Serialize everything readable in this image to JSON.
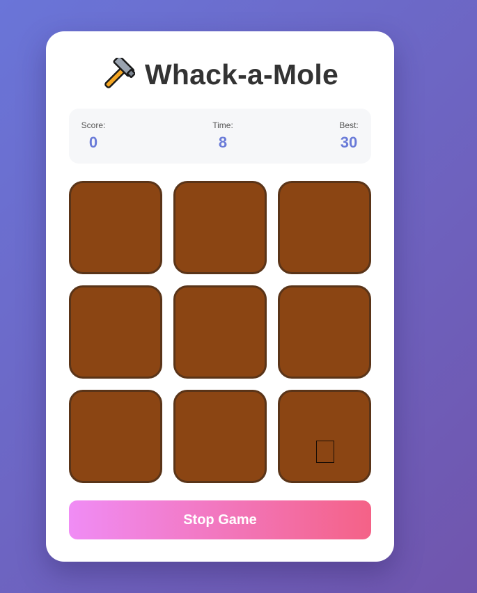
{
  "game": {
    "title": "Whack-a-Mole",
    "title_icon": "hammer-icon"
  },
  "stats": {
    "score_label": "Score:",
    "score_value": "0",
    "time_label": "Time:",
    "time_value": "8",
    "best_label": "Best:",
    "best_value": "30"
  },
  "board": {
    "rows": 3,
    "columns": 3,
    "active_hole": 9,
    "holes": [
      {
        "id": 1,
        "state": "empty"
      },
      {
        "id": 2,
        "state": "empty"
      },
      {
        "id": 3,
        "state": "empty"
      },
      {
        "id": 4,
        "state": "empty"
      },
      {
        "id": 5,
        "state": "empty"
      },
      {
        "id": 6,
        "state": "empty"
      },
      {
        "id": 7,
        "state": "empty"
      },
      {
        "id": 8,
        "state": "empty"
      },
      {
        "id": 9,
        "state": "mole"
      }
    ]
  },
  "controls": {
    "stop_label": "Stop Game"
  },
  "colors": {
    "accent": "#6a7bd8",
    "hole_fill": "#8b4513",
    "hole_border": "#5a3418",
    "button_gradient_start": "#f08cf5",
    "button_gradient_end": "#f46287"
  }
}
